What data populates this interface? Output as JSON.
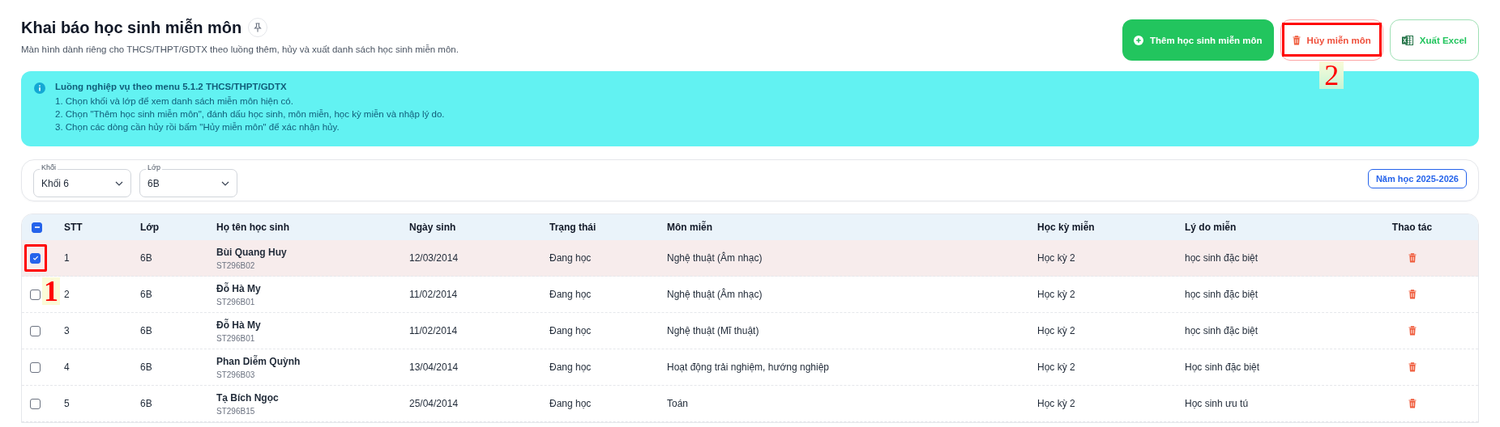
{
  "header": {
    "title": "Khai báo học sinh miễn môn",
    "subtitle": "Màn hình dành riêng cho THCS/THPT/GDTX theo luồng thêm, hủy và xuất danh sách học sinh miễn môn."
  },
  "actions": [
    {
      "kind": "add",
      "label": "Thêm học sinh miễn môn"
    },
    {
      "kind": "cancel",
      "label": "Hủy miễn môn",
      "annotation": "2"
    },
    {
      "kind": "excel",
      "label": "Xuất Excel"
    }
  ],
  "info": {
    "title": "Luồng nghiệp vụ theo menu 5.1.2 THCS/THPT/GDTX",
    "steps": [
      "1. Chọn khối và lớp để xem danh sách miễn môn hiện có.",
      "2. Chọn \"Thêm học sinh miễn môn\", đánh dấu học sinh, môn miễn, học kỳ miễn và nhập lý do.",
      "3. Chọn các dòng cần hủy rồi bấm \"Hủy miễn môn\" để xác nhận hủy."
    ]
  },
  "filters": [
    {
      "label": "Khối",
      "value": "Khối 6"
    },
    {
      "label": "Lớp",
      "value": "6B"
    }
  ],
  "school_year": "Năm học 2025-2026",
  "table": {
    "select_all_partial": true,
    "columns": [
      "STT",
      "Lớp",
      "Họ tên học sinh",
      "Ngày sinh",
      "Trạng thái",
      "Môn miễn",
      "Học kỳ miễn",
      "Lý do miễn",
      "Thao tác"
    ],
    "rows": [
      {
        "checked": true,
        "annotation": "1",
        "stt": "1",
        "class": "6B",
        "name": "Bùi Quang Huy",
        "code": "ST296B02",
        "dob": "12/03/2014",
        "status": "Đang học",
        "subject": "Nghệ thuật (Âm nhạc)",
        "term": "Học kỳ 2",
        "reason": "học sinh đặc biệt"
      },
      {
        "checked": false,
        "stt": "2",
        "class": "6B",
        "name": "Đỗ Hà My",
        "code": "ST296B01",
        "dob": "11/02/2014",
        "status": "Đang học",
        "subject": "Nghệ thuật (Âm nhạc)",
        "term": "Học kỳ 2",
        "reason": "học sinh đặc biệt"
      },
      {
        "checked": false,
        "stt": "3",
        "class": "6B",
        "name": "Đỗ Hà My",
        "code": "ST296B01",
        "dob": "11/02/2014",
        "status": "Đang học",
        "subject": "Nghệ thuật (Mĩ thuật)",
        "term": "Học kỳ 2",
        "reason": "học sinh đặc biệt"
      },
      {
        "checked": false,
        "stt": "4",
        "class": "6B",
        "name": "Phan Diễm Quỳnh",
        "code": "ST296B03",
        "dob": "13/04/2014",
        "status": "Đang học",
        "subject": "Hoạt động trải nghiệm, hướng nghiệp",
        "term": "Học kỳ 2",
        "reason": "Học sinh đặc biệt"
      },
      {
        "checked": false,
        "stt": "5",
        "class": "6B",
        "name": "Tạ Bích Ngọc",
        "code": "ST296B15",
        "dob": "25/04/2014",
        "status": "Đang học",
        "subject": "Toán",
        "term": "Học kỳ 2",
        "reason": "Học sinh ưu tú"
      }
    ]
  }
}
